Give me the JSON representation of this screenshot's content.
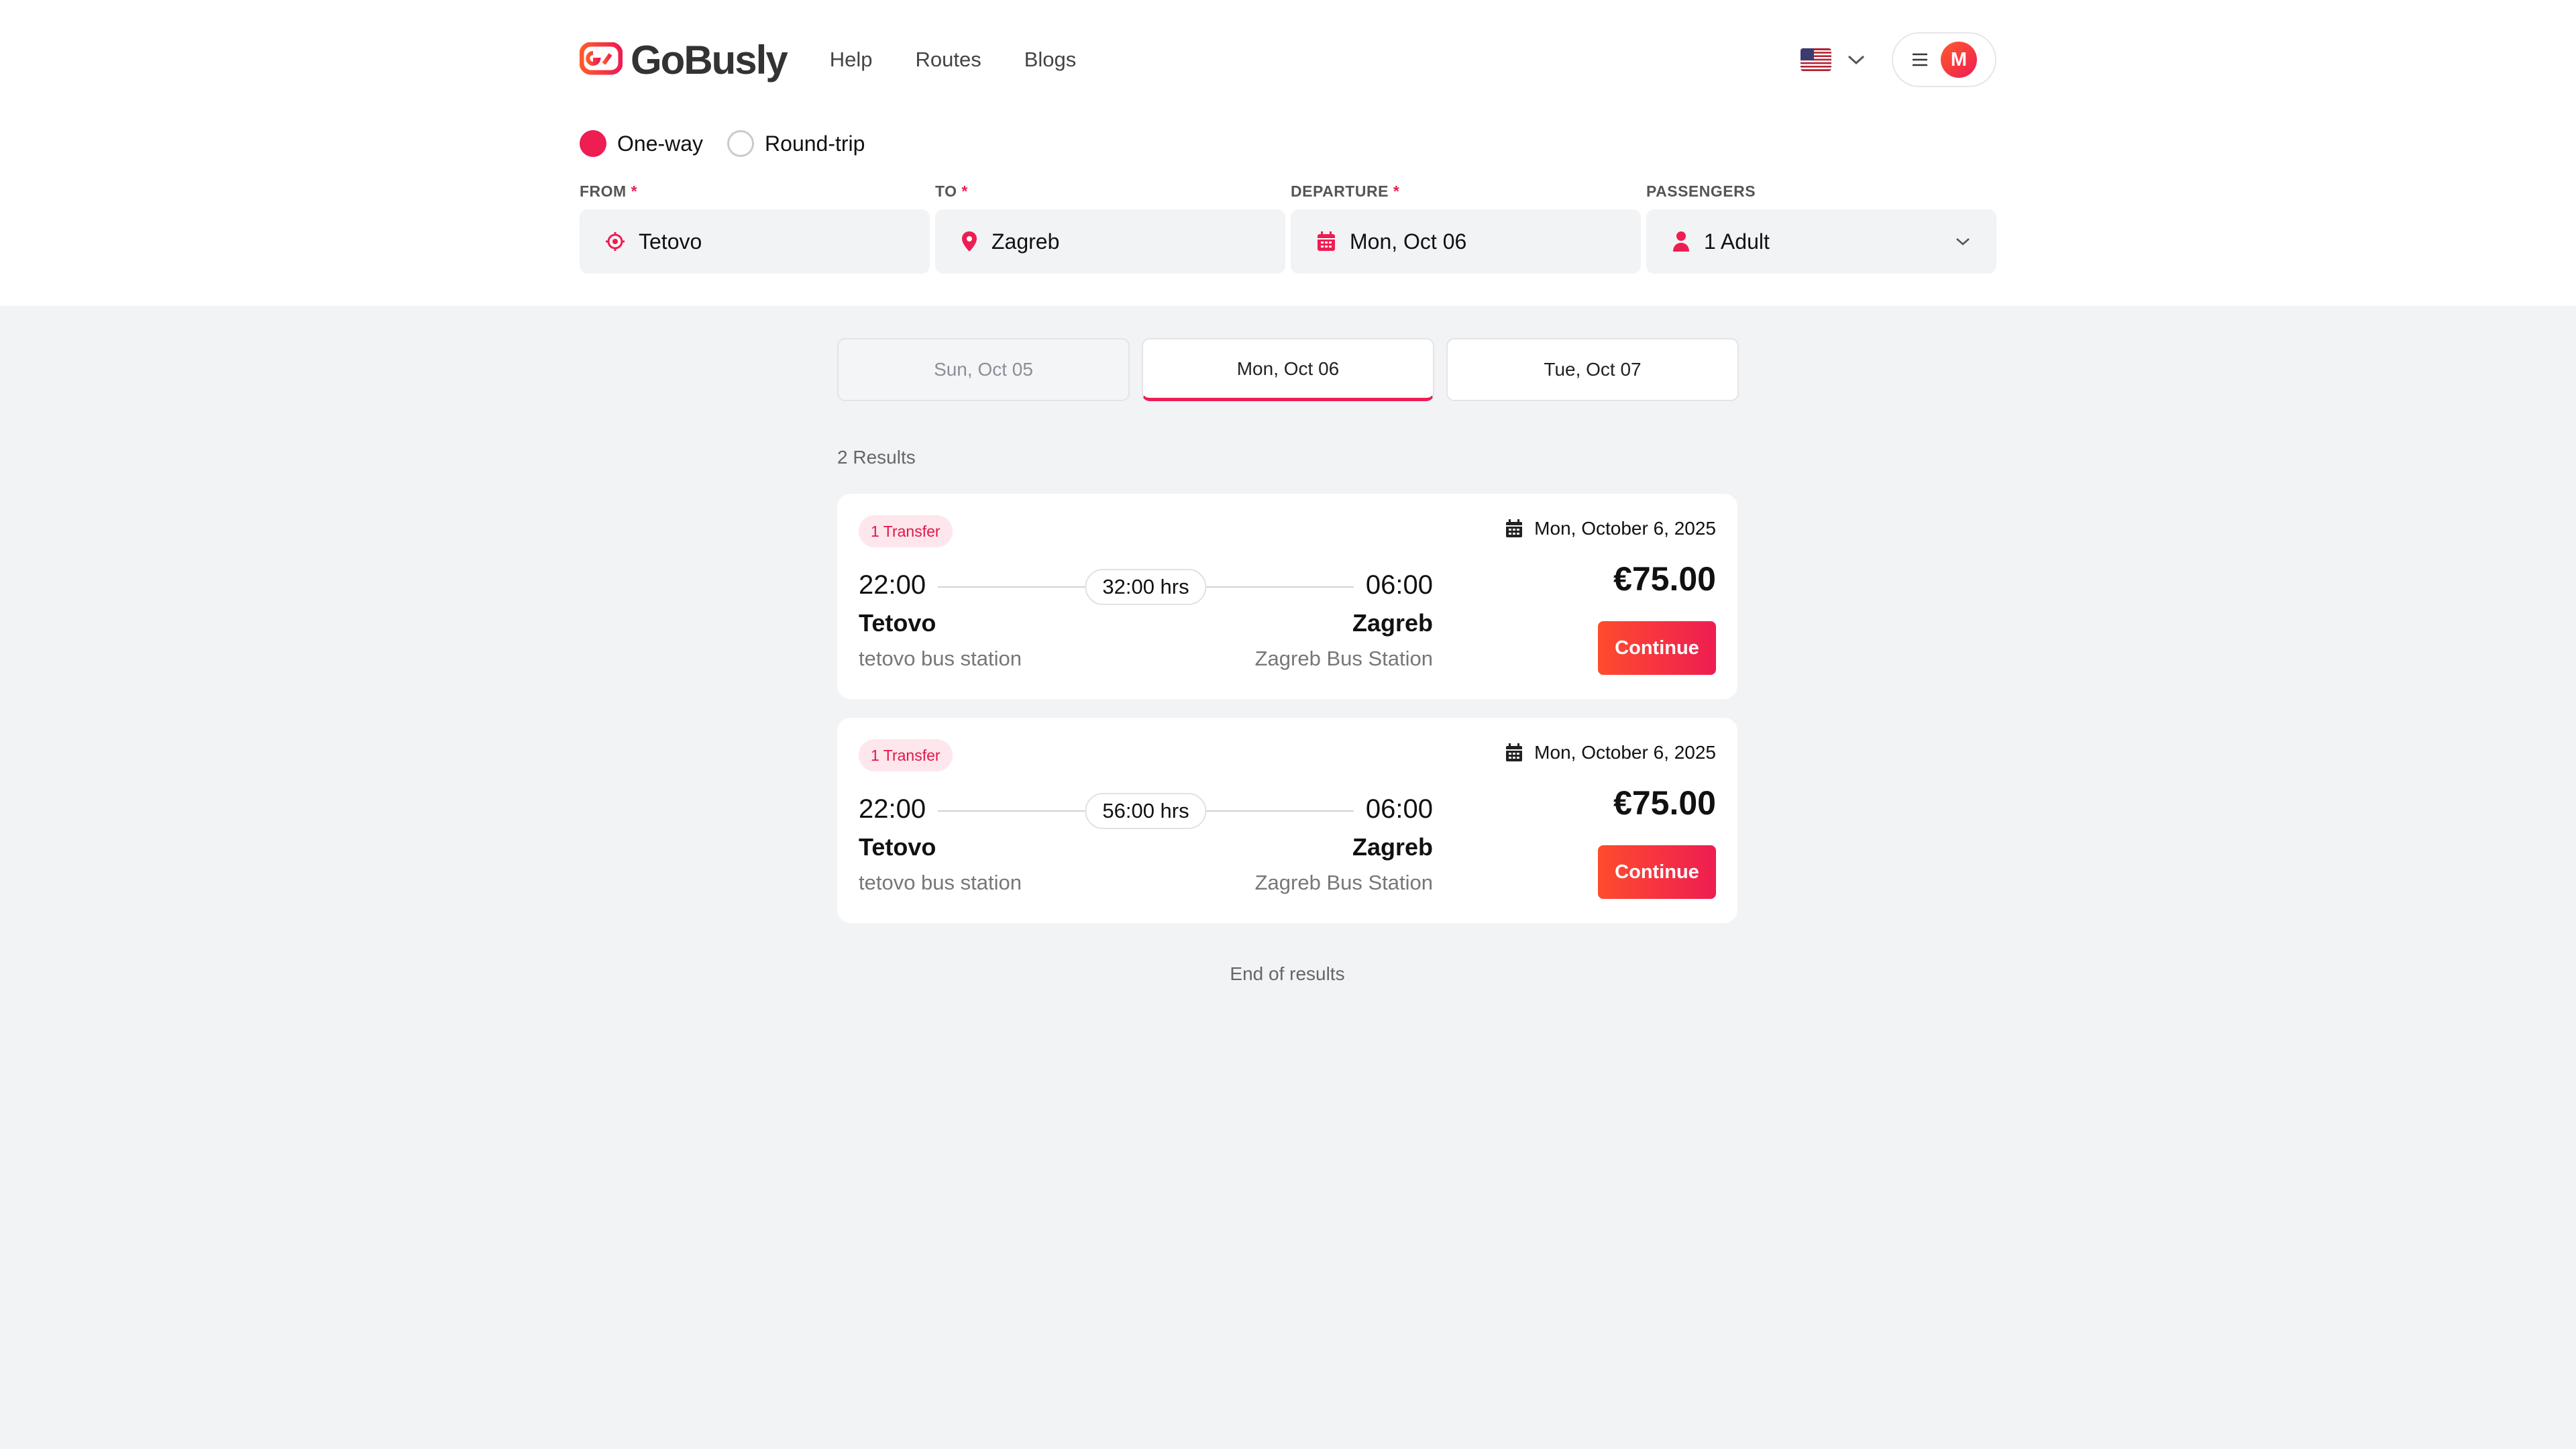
{
  "header": {
    "brand": "GoBusly",
    "nav": [
      "Help",
      "Routes",
      "Blogs"
    ],
    "user_initial": "M"
  },
  "search": {
    "trip_types": [
      {
        "label": "One-way",
        "selected": true
      },
      {
        "label": "Round-trip",
        "selected": false
      }
    ],
    "from": {
      "label": "FROM",
      "required": "*",
      "value": "Tetovo"
    },
    "to": {
      "label": "TO",
      "required": "*",
      "value": "Zagreb"
    },
    "departure": {
      "label": "DEPARTURE",
      "required": "*",
      "value": "Mon, Oct 06"
    },
    "passengers": {
      "label": "PASSENGERS",
      "value": "1 Adult"
    }
  },
  "date_tabs": [
    {
      "label": "Sun, Oct 05",
      "state": "disabled"
    },
    {
      "label": "Mon, Oct 06",
      "state": "active"
    },
    {
      "label": "Tue, Oct 07",
      "state": "normal"
    }
  ],
  "results": {
    "count_text": "2 Results",
    "items": [
      {
        "badge": "1 Transfer",
        "date": "Mon, October 6, 2025",
        "departure_time": "22:00",
        "arrival_time": "06:00",
        "duration": "32:00 hrs",
        "from_city": "Tetovo",
        "to_city": "Zagreb",
        "from_station": "tetovo bus station",
        "to_station": "Zagreb Bus Station",
        "price": "€75.00",
        "button": "Continue"
      },
      {
        "badge": "1 Transfer",
        "date": "Mon, October 6, 2025",
        "departure_time": "22:00",
        "arrival_time": "06:00",
        "duration": "56:00 hrs",
        "from_city": "Tetovo",
        "to_city": "Zagreb",
        "from_station": "tetovo bus station",
        "to_station": "Zagreb Bus Station",
        "price": "€75.00",
        "button": "Continue"
      }
    ],
    "end_text": "End of results"
  },
  "colors": {
    "accent": "#ee1d52",
    "accent_orange": "#ff4b2e",
    "page_bg": "#f2f3f5"
  },
  "icons": [
    "gobusly-logo-icon",
    "us-flag-icon",
    "chevron-down-icon",
    "hamburger-icon",
    "origin-target-icon",
    "location-pin-icon",
    "calendar-icon",
    "person-icon"
  ]
}
